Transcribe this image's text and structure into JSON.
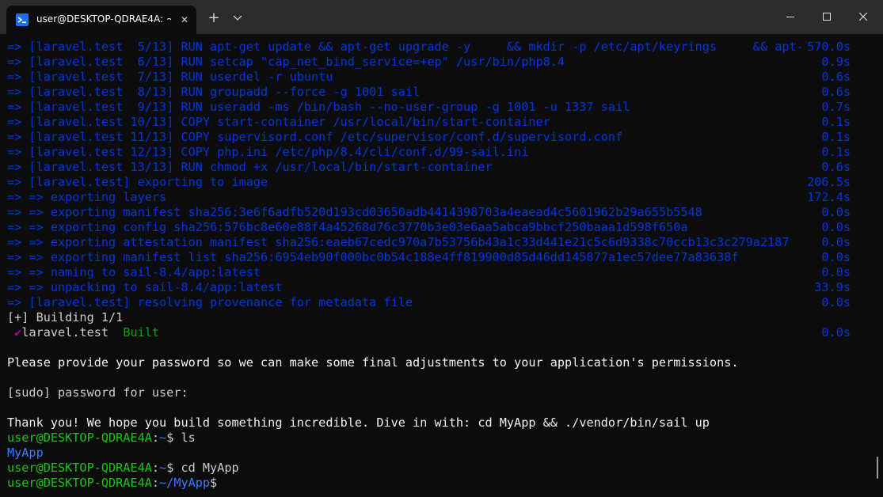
{
  "window": {
    "tab_title": "user@DESKTOP-QDRAE4A: ~/",
    "tab_close": "✕",
    "new_tab": "+"
  },
  "terminal": {
    "lines": [
      {
        "text": "=> [laravel.test  5/13] RUN apt-get update && apt-get upgrade -y     && mkdir -p /etc/apt/keyrings     && apt-",
        "time": "570.0s"
      },
      {
        "text": "=> [laravel.test  6/13] RUN setcap \"cap_net_bind_service=+ep\" /usr/bin/php8.4",
        "time": "0.9s"
      },
      {
        "text": "=> [laravel.test  7/13] RUN userdel -r ubuntu",
        "time": "0.6s"
      },
      {
        "text": "=> [laravel.test  8/13] RUN groupadd --force -g 1001 sail",
        "time": "0.6s"
      },
      {
        "text": "=> [laravel.test  9/13] RUN useradd -ms /bin/bash --no-user-group -g 1001 -u 1337 sail",
        "time": "0.7s"
      },
      {
        "text": "=> [laravel.test 10/13] COPY start-container /usr/local/bin/start-container",
        "time": "0.1s"
      },
      {
        "text": "=> [laravel.test 11/13] COPY supervisord.conf /etc/supervisor/conf.d/supervisord.conf",
        "time": "0.1s"
      },
      {
        "text": "=> [laravel.test 12/13] COPY php.ini /etc/php/8.4/cli/conf.d/99-sail.ini",
        "time": "0.1s"
      },
      {
        "text": "=> [laravel.test 13/13] RUN chmod +x /usr/local/bin/start-container",
        "time": "0.6s"
      },
      {
        "text": "=> [laravel.test] exporting to image",
        "time": "206.5s"
      },
      {
        "text": "=> => exporting layers",
        "time": "172.4s"
      },
      {
        "text": "=> => exporting manifest sha256:3e6f6adfb520d193cd03650adb4414398703a4eaead4c5601962b29a655b5548",
        "time": "0.0s"
      },
      {
        "text": "=> => exporting config sha256:576bc8e60e88f4a45268d76c3770b3e03e6aa5abca9bbcf250baaa1d598f650a",
        "time": "0.0s"
      },
      {
        "text": "=> => exporting attestation manifest sha256:eaeb67cedc970a7b53756b43a1c33d441e21c5c6d9338c70ccb13c3c279a2187",
        "time": "0.0s"
      },
      {
        "text": "=> => exporting manifest list sha256:6954eb90f000bc0b54c188e4ff819900d85d46dd145877a1ec57dee77a83638f",
        "time": "0.0s"
      },
      {
        "text": "=> => naming to sail-8.4/app:latest",
        "time": "0.0s"
      },
      {
        "text": "=> => unpacking to sail-8.4/app:latest",
        "time": "33.9s"
      },
      {
        "text": "=> [laravel.test] resolving provenance for metadata file",
        "time": "0.0s"
      }
    ],
    "building": "[+] Building 1/1",
    "built_check": "✔",
    "built_name": "laravel.test",
    "built_status": "Built",
    "built_time": "0.0s",
    "password_msg": "Please provide your password so we can make some final adjustments to your application's permissions.",
    "sudo_prompt": "[sudo] password for user:",
    "thank_you": "Thank you! We hope you build something incredible. Dive in with: cd MyApp && ./vendor/bin/sail up",
    "prompt_user": "user@DESKTOP-QDRAE4A",
    "colon": ":",
    "home": "~",
    "dollar": "$",
    "cmd_ls": " ls",
    "ls_output": "MyApp",
    "cmd_cd": " cd MyApp",
    "path_myapp": "~/MyApp"
  },
  "colors": {
    "background": "#0c0c0c",
    "titlebar": "#2b2b2b",
    "build_text": "#0037da",
    "prompt_user": "#16c60c",
    "prompt_path": "#3b78ff"
  }
}
